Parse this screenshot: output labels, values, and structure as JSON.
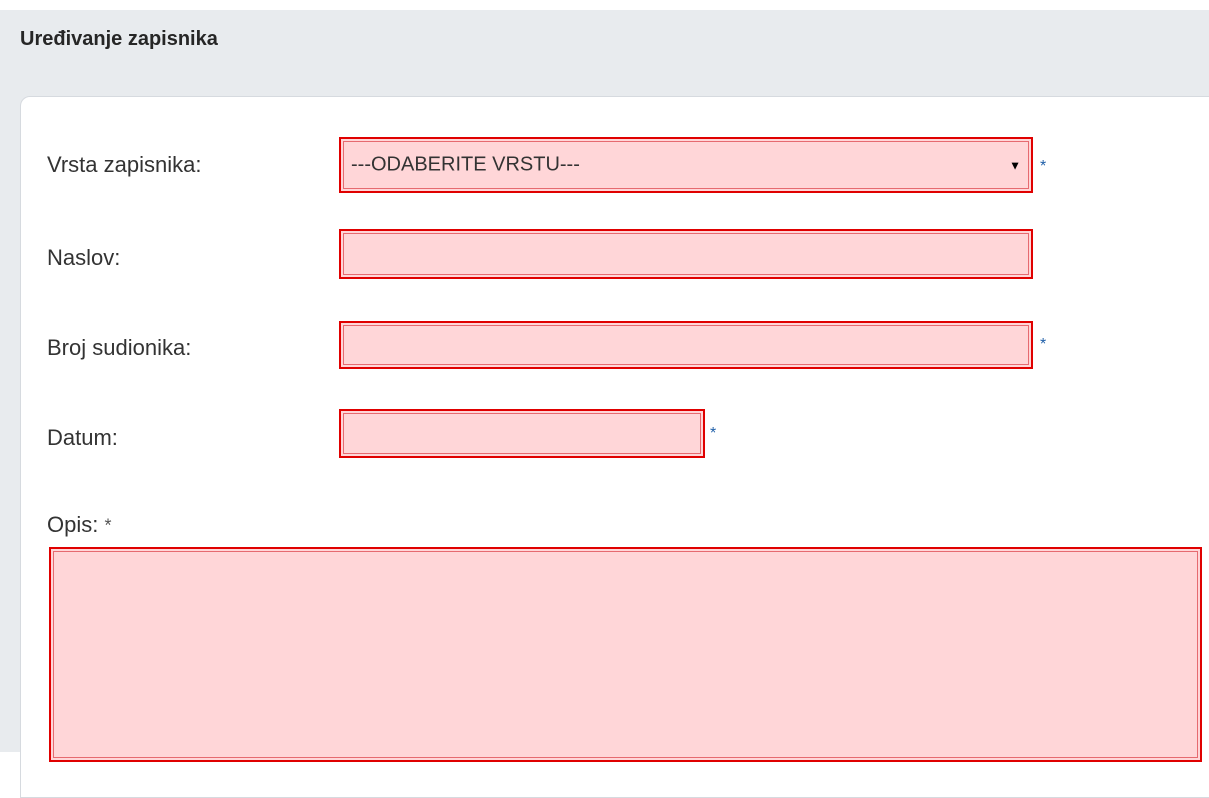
{
  "page": {
    "title": "Uređivanje zapisnika"
  },
  "form": {
    "vrsta": {
      "label": "Vrsta zapisnika:",
      "selected": "---ODABERITE VRSTU---",
      "required_mark": "*"
    },
    "naslov": {
      "label": "Naslov:",
      "value": ""
    },
    "broj": {
      "label": "Broj sudionika:",
      "value": "",
      "required_mark": "*"
    },
    "datum": {
      "label": "Datum:",
      "value": "",
      "required_mark": "*"
    },
    "opis": {
      "label": "Opis:",
      "value": "",
      "required_mark": "*"
    }
  },
  "icons": {
    "select_arrow": "dropdown-arrow-icon",
    "arrow_glyph": "▼"
  },
  "colors": {
    "error_fill": "#ffd6d8",
    "error_border": "#e00000",
    "required_mark": "#1f5fa8",
    "header_bg": "#e8ebee"
  }
}
